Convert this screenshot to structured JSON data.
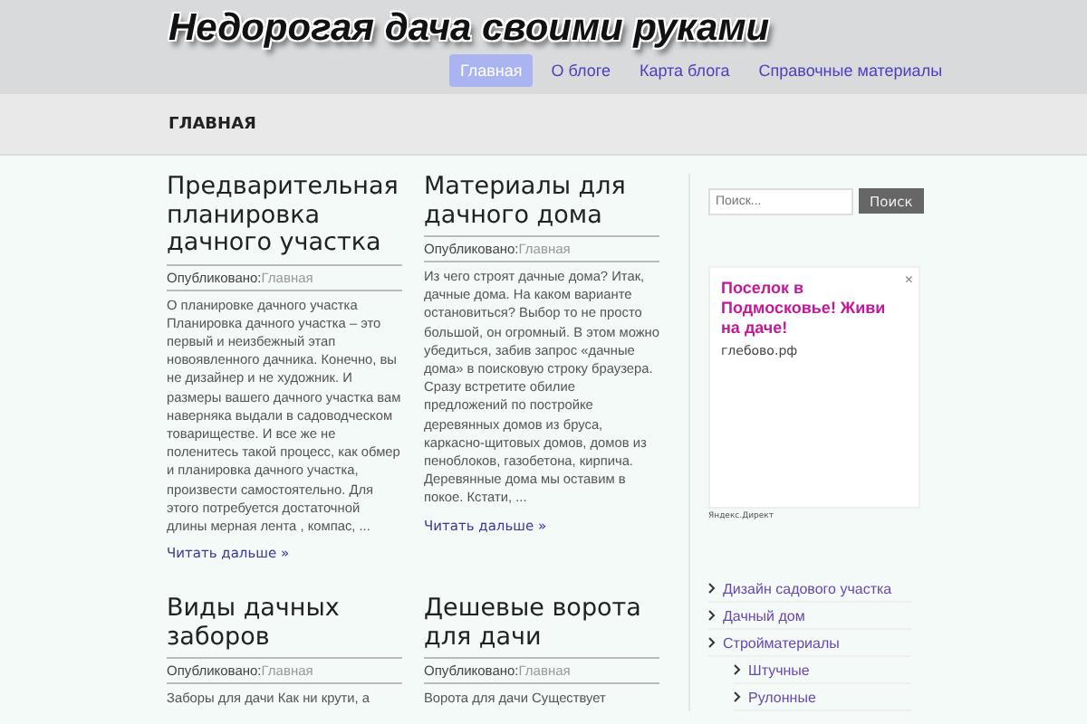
{
  "site_title": "Недорогая дача своими руками",
  "nav": [
    {
      "label": "Главная",
      "selected": true
    },
    {
      "label": "О блоге",
      "selected": false
    },
    {
      "label": "Карта блога",
      "selected": false
    },
    {
      "label": "Справочные материалы",
      "selected": false
    }
  ],
  "breadcrumb": "ГЛАВНАЯ",
  "posts": [
    {
      "title": "Предварительная планировка дачного участка",
      "meta_label": "Опубликовано:",
      "category": "Главная",
      "excerpt": "О планировке дачного участка Планировка дачного участка  – это первый и неизбежный этап новоявленного дачника. Конечно, вы не дизайнер и не художник. И размеры вашего дачного участка вам наверняка выдали в садоводческом товариществе. И все же не поленитесь такой процесс, как обмер и планировка дачного участка, произвести самостоятельно. Для этого потребуется достаточной длины мерная лента , компас, ...",
      "more": "Читать дальше »"
    },
    {
      "title": "Материалы для дачного дома",
      "meta_label": "Опубликовано:",
      "category": "Главная",
      "excerpt": "Из чего строят дачные дома? Итак, дачные дома. На каком варианте остановиться? Выбор то не просто большой, он огромный. В этом можно убедиться, забив запрос «дачные дома» в поисковую строку браузера. Сразу встретите обилие предложений по постройке деревянных домов из бруса, каркасно-щитовых домов, домов из пеноблоков, газобетона, кирпича. Деревянные дома мы оставим в покое. Кстати, ...",
      "more": "Читать дальше »"
    },
    {
      "title": "Виды дачных заборов",
      "meta_label": "Опубликовано:",
      "category": "Главная",
      "excerpt": "Заборы для дачи Как ни крути, а"
    },
    {
      "title": "Дешевые ворота для дачи",
      "meta_label": "Опубликовано:",
      "category": "Главная",
      "excerpt": "Ворота для дачи Существует"
    }
  ],
  "search": {
    "placeholder": "Поиск...",
    "button": "Поиск"
  },
  "ad": {
    "headline": "Поселок в Подмосковье! Живи на даче!",
    "domain": "глебово.рф",
    "close": "×",
    "source": "Яндекс.Директ"
  },
  "categories": [
    {
      "label": "Дизайн садового участка"
    },
    {
      "label": "Дачный дом"
    },
    {
      "label": "Стройматериалы",
      "children": [
        {
          "label": "Штучные"
        },
        {
          "label": "Рулонные"
        }
      ]
    }
  ]
}
